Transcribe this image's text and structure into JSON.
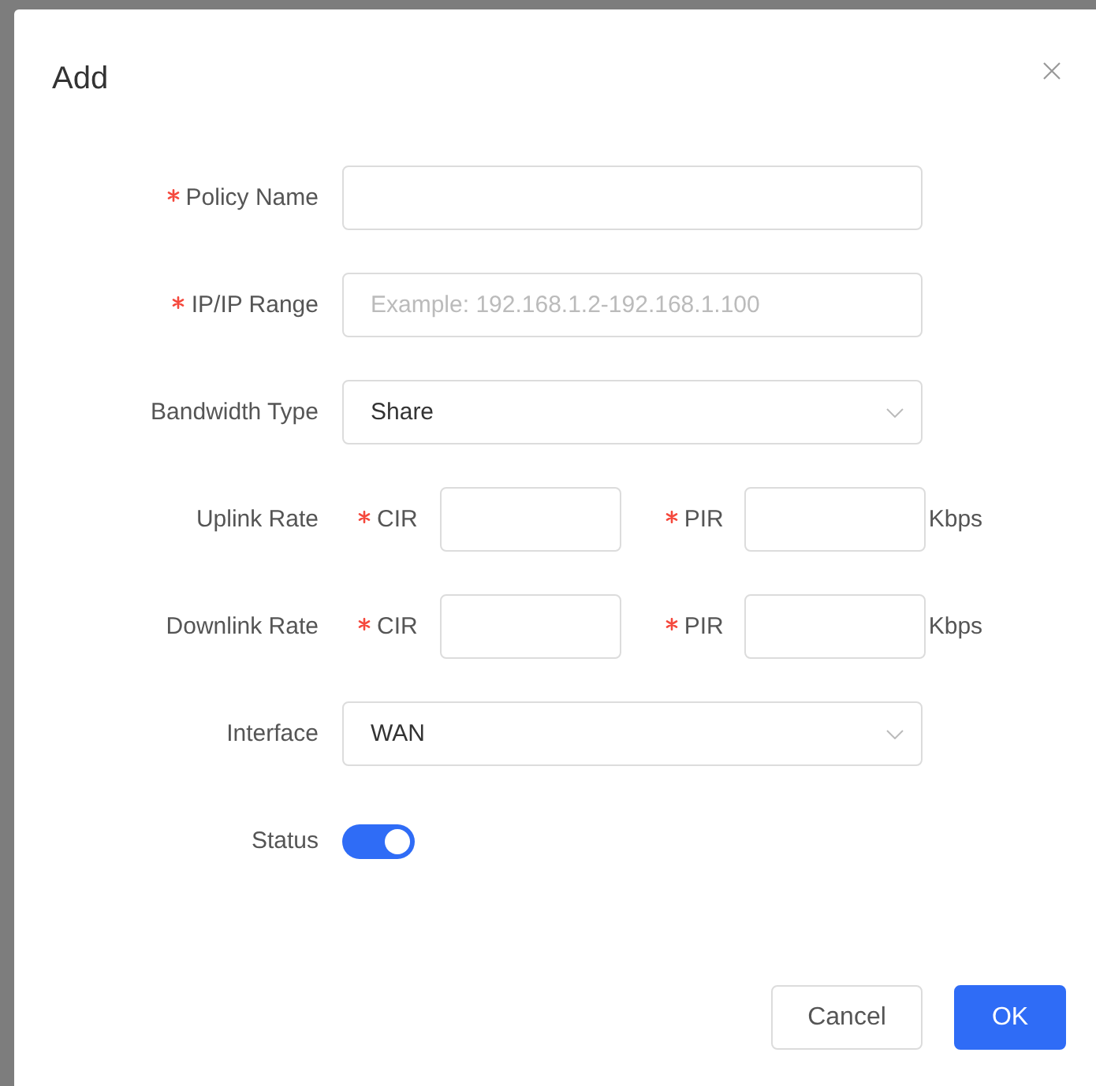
{
  "dialog": {
    "title": "Add"
  },
  "fields": [
    {
      "kind": "text",
      "label": "Policy Name",
      "required": true
    },
    {
      "kind": "text",
      "label": "IP/IP Range",
      "required": true,
      "placeholder": "Example: 192.168.1.2-192.168.1.100"
    },
    {
      "kind": "select",
      "label": "Bandwidth Type",
      "required": false,
      "value": "Share"
    },
    {
      "kind": "rate",
      "label": "Uplink Rate",
      "required": false,
      "inputs": [
        {
          "label": "CIR",
          "required": true
        },
        {
          "label": "PIR",
          "required": true
        }
      ],
      "unit": "Kbps"
    },
    {
      "kind": "rate",
      "label": "Downlink Rate",
      "required": false,
      "inputs": [
        {
          "label": "CIR",
          "required": true
        },
        {
          "label": "PIR",
          "required": true
        }
      ],
      "unit": "Kbps"
    },
    {
      "kind": "select",
      "label": "Interface",
      "required": false,
      "value": "WAN"
    },
    {
      "kind": "switch",
      "label": "Status",
      "required": false,
      "on": true
    }
  ],
  "buttons": [
    {
      "label": "Cancel",
      "primary": false
    },
    {
      "label": "OK",
      "primary": true
    }
  ]
}
